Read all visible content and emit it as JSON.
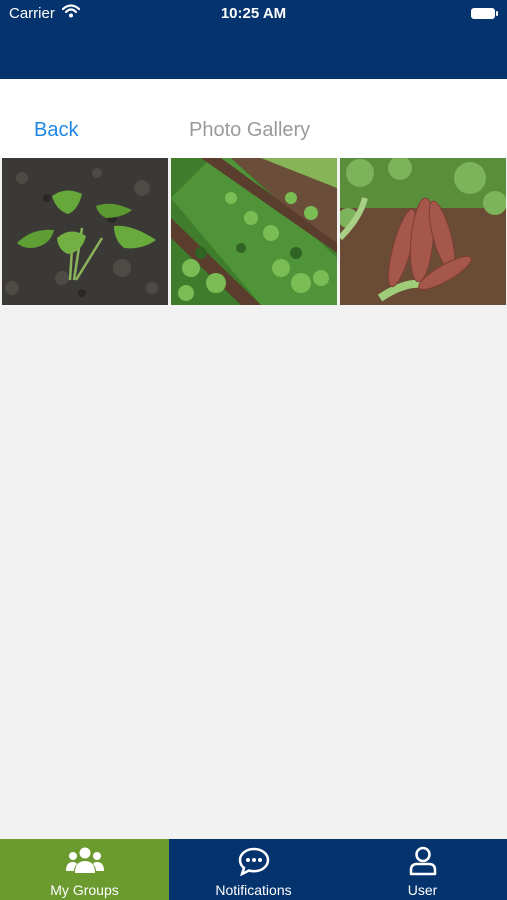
{
  "status_bar": {
    "carrier": "Carrier",
    "time": "10:25 AM"
  },
  "nav": {
    "back_label": "Back",
    "title": "Photo Gallery"
  },
  "gallery": {
    "photos": [
      {
        "subject": "sweet potato seedling in soil"
      },
      {
        "subject": "rows of sweet potato plants in field"
      },
      {
        "subject": "harvested sweet potatoes on soil"
      }
    ]
  },
  "tab_bar": {
    "tabs": [
      {
        "label": "My Groups",
        "icon": "groups-icon",
        "active": true
      },
      {
        "label": "Notifications",
        "icon": "chat-bubble-icon",
        "active": false
      },
      {
        "label": "User",
        "icon": "user-icon",
        "active": false
      }
    ]
  },
  "colors": {
    "header_blue": "#04336e",
    "active_tab_green": "#6b9a2e",
    "link_blue": "#1e88e5",
    "title_gray": "#9a9a9a",
    "background": "#f2f2f2"
  }
}
